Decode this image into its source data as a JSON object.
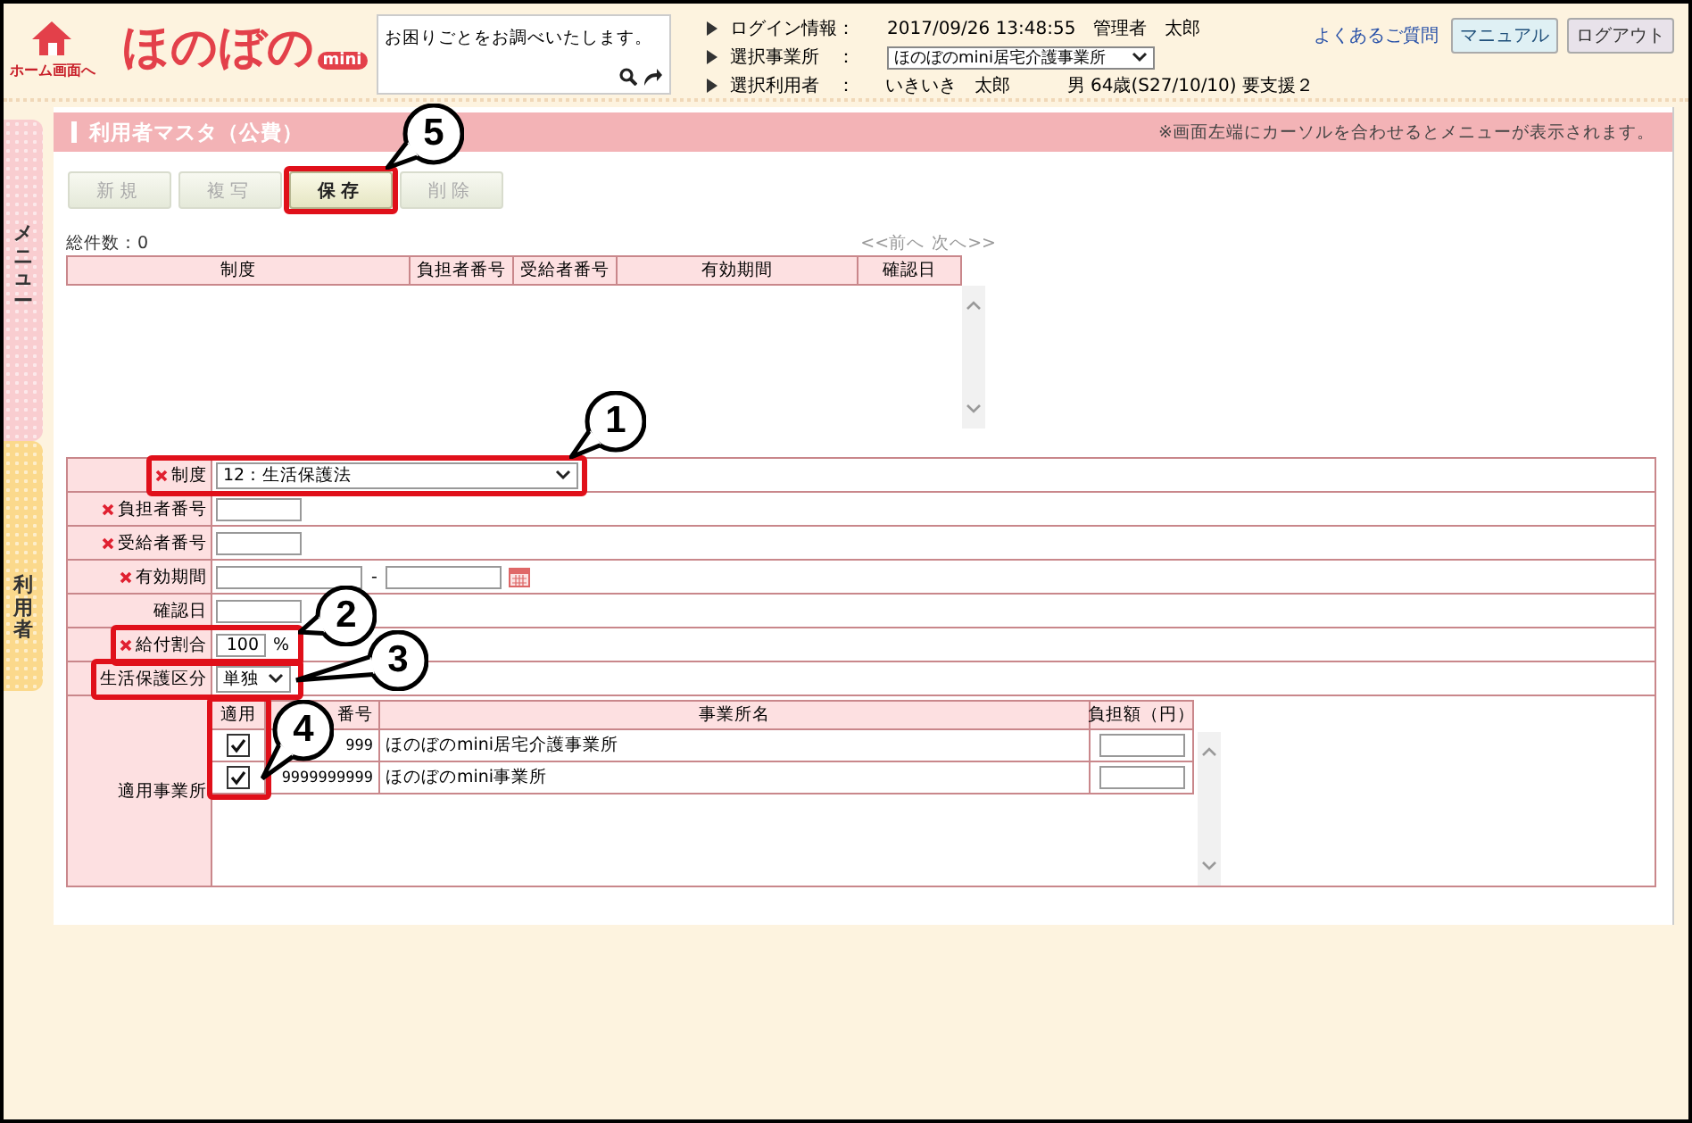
{
  "header": {
    "home_label": "ホーム画面へ",
    "logo": "ほのぼの",
    "logo_badge": "mini",
    "search_text": "お困りごとをお調べいたします。",
    "info": [
      {
        "label": "ログイン情報：",
        "kind": "text",
        "value": "2017/09/26 13:48:55　管理者　太郎"
      },
      {
        "label": "選択事業所　：",
        "kind": "select",
        "value": "ほのぼのmini居宅介護事業所"
      },
      {
        "label": "選択利用者　：",
        "kind": "text",
        "value": "いきいき　太郎",
        "extra": "男 64歳(S27/10/10) 要支援２"
      }
    ],
    "faq_link": "よくあるご質問",
    "buttons": [
      "マニュアル",
      "ログアウト"
    ]
  },
  "side_tabs": [
    {
      "label": "メニュー",
      "color": "#f9cdd0"
    },
    {
      "label": "利用者",
      "color": "#fbd98c"
    }
  ],
  "page": {
    "title": "利用者マスタ（公費）",
    "note": "※画面左端にカーソルを合わせるとメニューが表示されます。"
  },
  "toolbar": [
    {
      "label": "新規",
      "disabled": true
    },
    {
      "label": "複写",
      "disabled": true
    },
    {
      "label": "保存",
      "disabled": false
    },
    {
      "label": "削除",
      "disabled": true
    }
  ],
  "list": {
    "count": "総件数：0",
    "prev": "<<前へ",
    "next": "次へ>>",
    "columns": [
      "制度",
      "負担者番号",
      "受給者番号",
      "有効期間",
      "確認日"
    ]
  },
  "form": {
    "rows": [
      {
        "label": "制度",
        "required": true,
        "kind": "select",
        "value": "12：生活保護法"
      },
      {
        "label": "負担者番号",
        "required": true,
        "kind": "text"
      },
      {
        "label": "受給者番号",
        "required": true,
        "kind": "text"
      },
      {
        "label": "有効期間",
        "required": true,
        "kind": "period",
        "separator": "-"
      },
      {
        "label": "確認日",
        "required": false,
        "kind": "text"
      },
      {
        "label": "給付割合",
        "required": true,
        "kind": "percent",
        "value": "100",
        "unit": "%"
      },
      {
        "label": "生活保護区分",
        "required": false,
        "kind": "select",
        "value": "単独"
      }
    ]
  },
  "offices": {
    "label": "適用事業所",
    "columns": [
      "適用",
      "番号",
      "事業所名",
      "負担額（円）"
    ],
    "rows": [
      {
        "applied": true,
        "code": "999",
        "name": "ほのぼのmini居宅介護事業所"
      },
      {
        "applied": true,
        "code": "9999999999",
        "name": "ほのぼのmini事業所"
      }
    ]
  },
  "callouts": [
    {
      "number": "5"
    },
    {
      "number": "1"
    },
    {
      "number": "2"
    },
    {
      "number": "3"
    },
    {
      "number": "4"
    }
  ]
}
